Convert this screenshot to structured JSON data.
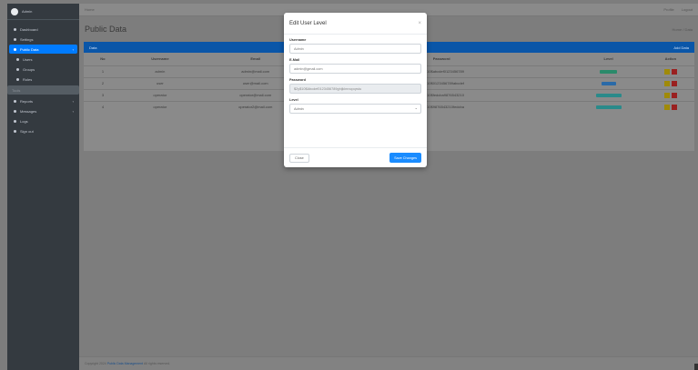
{
  "app": {
    "brand": "Admin"
  },
  "sidebar": {
    "items": [
      {
        "label": "Dashboard",
        "active": false
      },
      {
        "label": "Settings",
        "active": false
      },
      {
        "label": "Public Data",
        "active": true
      },
      {
        "label": "Users",
        "active": false,
        "sub": true
      },
      {
        "label": "Groups",
        "active": false,
        "sub": true
      },
      {
        "label": "Roles",
        "active": false,
        "sub": true
      },
      {
        "label": "Tools",
        "header": true
      },
      {
        "label": "Reports",
        "active": false
      },
      {
        "label": "Messages",
        "active": false
      },
      {
        "label": "Logs",
        "active": false
      },
      {
        "label": "Sign out",
        "active": false
      }
    ]
  },
  "topbar": {
    "left": "Home",
    "right_a": "Profile",
    "right_b": "Logout"
  },
  "page": {
    "title": "Public Data",
    "breadcrumb": "Home / Data"
  },
  "card": {
    "header_left": "Data",
    "header_right": "Add Data",
    "columns": [
      "No",
      "Username",
      "Email",
      "Password",
      "Level",
      "Action"
    ],
    "rows": [
      {
        "no": "1",
        "username": "admin",
        "email": "admin@mail.com",
        "password": "$2y$10$abcdef0123456789",
        "level": "admin",
        "level_color": "#2a8a6a"
      },
      {
        "no": "2",
        "username": "user",
        "email": "user@mail.com",
        "password": "$2y$10$0123456789abcdef",
        "level": "user",
        "level_color": "#2a6aa8"
      },
      {
        "no": "3",
        "username": "operator",
        "email": "operator@mail.com",
        "password": "$2y$10$fedcba9876543210",
        "level": "operator",
        "level_color": "#2a8a8a"
      },
      {
        "no": "4",
        "username": "operator",
        "email": "operator2@mail.com",
        "password": "$2y$10$9876543210fedcba",
        "level": "operator",
        "level_color": "#2a8a8a"
      }
    ]
  },
  "modal": {
    "title": "Edit User Level",
    "username_label": "Username",
    "username_placeholder": "Admin",
    "email_label": "E-Mail",
    "email_placeholder": "admin@gmail.com",
    "password_label": "Password",
    "password_value": "$2y$10$Abcdef0123456789ghijklmnopqrstu",
    "level_label": "Level",
    "level_value": "Admin",
    "close_label": "Close",
    "save_label": "Save Changes"
  },
  "footer": {
    "text": "Copyright 2024",
    "link": "Public Data Management",
    "suffix": "All rights reserved."
  }
}
